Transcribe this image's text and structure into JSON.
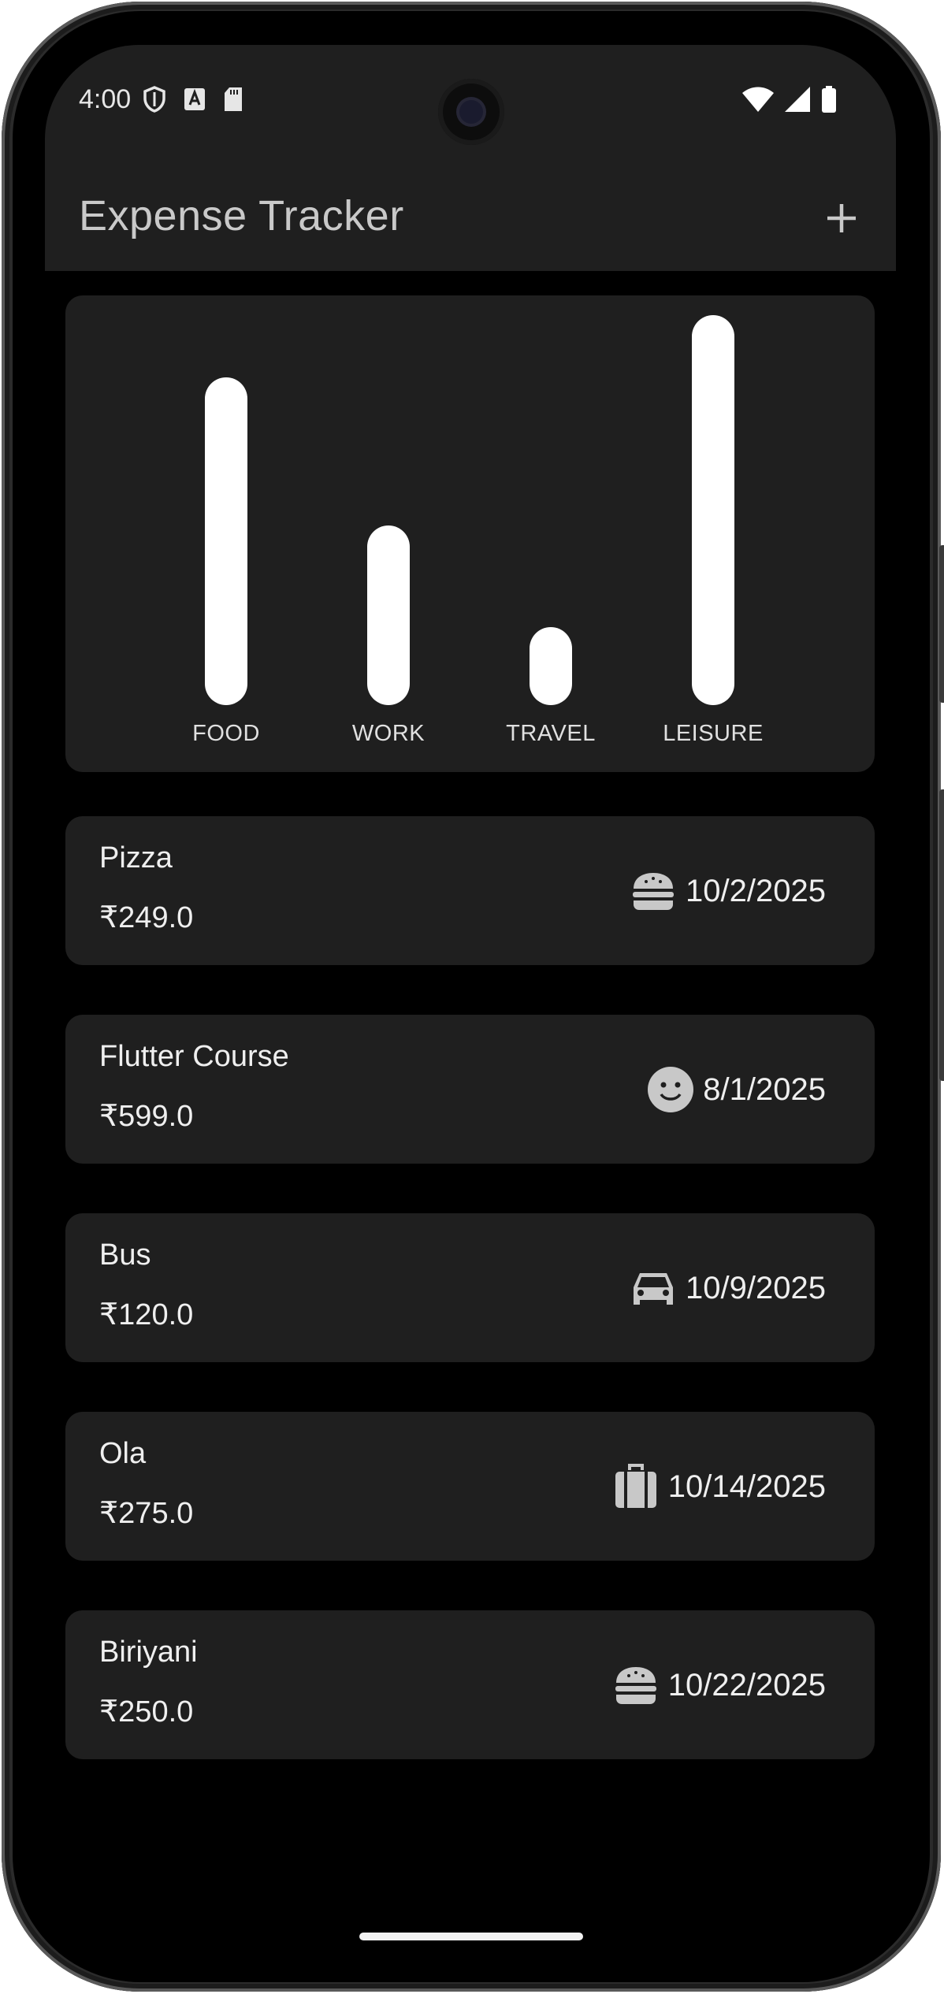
{
  "status_bar": {
    "time": "4:00",
    "left_icons": [
      "shield-icon",
      "text-a-icon",
      "sd-card-icon"
    ],
    "right_icons": [
      "wifi-icon",
      "cell-signal-icon",
      "battery-icon"
    ]
  },
  "app_bar": {
    "title": "Expense Tracker",
    "add_icon": "plus-icon"
  },
  "chart_data": {
    "type": "bar",
    "categories": [
      "FOOD",
      "WORK",
      "TRAVEL",
      "LEISURE"
    ],
    "values": [
      0.84,
      0.46,
      0.2,
      1.0
    ],
    "bar_color": "#ffffff",
    "background": "#1f1f1f"
  },
  "expenses": [
    {
      "title": "Pizza",
      "amount": "₹249.0",
      "category_icon": "burger-icon",
      "date": "10/2/2025"
    },
    {
      "title": "Flutter Course",
      "amount": "₹599.0",
      "category_icon": "smiley-icon",
      "date": "8/1/2025"
    },
    {
      "title": "Bus",
      "amount": "₹120.0",
      "category_icon": "car-icon",
      "date": "10/9/2025"
    },
    {
      "title": "Ola",
      "amount": "₹275.0",
      "category_icon": "luggage-icon",
      "date": "10/14/2025"
    },
    {
      "title": "Biriyani",
      "amount": "₹250.0",
      "category_icon": "burger-icon",
      "date": "10/22/2025"
    }
  ],
  "colors": {
    "background": "#000000",
    "surface": "#1f1f1f",
    "text": "#efefef",
    "icon": "#c8c8c8"
  }
}
